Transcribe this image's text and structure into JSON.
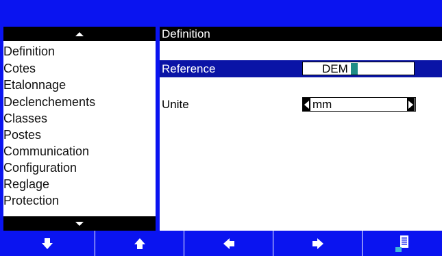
{
  "menu": {
    "items": [
      {
        "label": "Definition"
      },
      {
        "label": "Cotes"
      },
      {
        "label": "Etalonnage"
      },
      {
        "label": "Declenchements"
      },
      {
        "label": "Classes"
      },
      {
        "label": "Postes"
      },
      {
        "label": "Communication"
      },
      {
        "label": "Configuration"
      },
      {
        "label": "Reglage"
      },
      {
        "label": "Protection"
      }
    ]
  },
  "panel": {
    "title": "Definition",
    "reference": {
      "label": "Reference",
      "value": "DEM"
    },
    "unite": {
      "label": "Unite",
      "value": "mm"
    }
  },
  "colors": {
    "background": "#0a14f0",
    "selected_row": "#0a14a6",
    "cursor": "#1f8c87"
  },
  "function_keys": [
    {
      "icon": "arrow-down-icon"
    },
    {
      "icon": "arrow-up-icon"
    },
    {
      "icon": "arrow-left-icon"
    },
    {
      "icon": "arrow-right-icon"
    },
    {
      "icon": "document-list-icon"
    }
  ]
}
